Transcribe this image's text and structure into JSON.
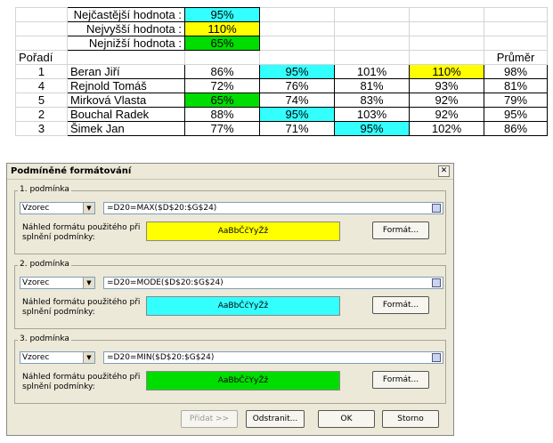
{
  "sheet": {
    "summary": [
      {
        "label": "Nejčastější hodnota :",
        "value": "95%"
      },
      {
        "label": "Nejvyšší hodnota :",
        "value": "110%"
      },
      {
        "label": "Nejnižší hodnota :",
        "value": "65%"
      }
    ],
    "header": {
      "rank": "Pořadí",
      "average": "Průměr"
    },
    "rows": [
      {
        "rank": "1",
        "name": "Beran Jiří",
        "v1": "86%",
        "v2": "95%",
        "v3": "101%",
        "v4": "110%",
        "avg": "98%"
      },
      {
        "rank": "4",
        "name": "Rejnold Tomáš",
        "v1": "72%",
        "v2": "76%",
        "v3": "81%",
        "v4": "93%",
        "avg": "81%"
      },
      {
        "rank": "5",
        "name": "Mirková Vlasta",
        "v1": "65%",
        "v2": "74%",
        "v3": "83%",
        "v4": "92%",
        "avg": "79%"
      },
      {
        "rank": "2",
        "name": "Bouchal Radek",
        "v1": "88%",
        "v2": "95%",
        "v3": "103%",
        "v4": "92%",
        "avg": "95%"
      },
      {
        "rank": "3",
        "name": "Šimek Jan",
        "v1": "77%",
        "v2": "71%",
        "v3": "95%",
        "v4": "102%",
        "avg": "86%"
      }
    ],
    "colors": {
      "mode": "#33ffff",
      "max": "#ffff00",
      "min": "#00dd00"
    }
  },
  "dialog": {
    "title": "Podmíněné formátování",
    "close": "✕",
    "conditions": [
      {
        "label": "1. podmínka",
        "type": "Vzorec",
        "formula": "=D20=MAX($D$20:$G$24)",
        "preview_label": "Náhled formátu použitého při splnění podmínky:",
        "preview_text": "AaBbČčYyŽž",
        "preview_color": "#ffff00",
        "format_button": "Formát..."
      },
      {
        "label": "2. podmínka",
        "type": "Vzorec",
        "formula": "=D20=MODE($D$20:$G$24)",
        "preview_label": "Náhled formátu použitého při splnění podmínky:",
        "preview_text": "AaBbČčYyŽž",
        "preview_color": "#33ffff",
        "format_button": "Formát..."
      },
      {
        "label": "3. podmínka",
        "type": "Vzorec",
        "formula": "=D20=MIN($D$20:$G$24)",
        "preview_label": "Náhled formátu použitého při splnění podmínky:",
        "preview_text": "AaBbČčYyŽž",
        "preview_color": "#00dd00",
        "format_button": "Formát..."
      }
    ],
    "buttons": {
      "add": "Přidat >>",
      "remove": "Odstranit...",
      "ok": "OK",
      "cancel": "Storno"
    }
  }
}
